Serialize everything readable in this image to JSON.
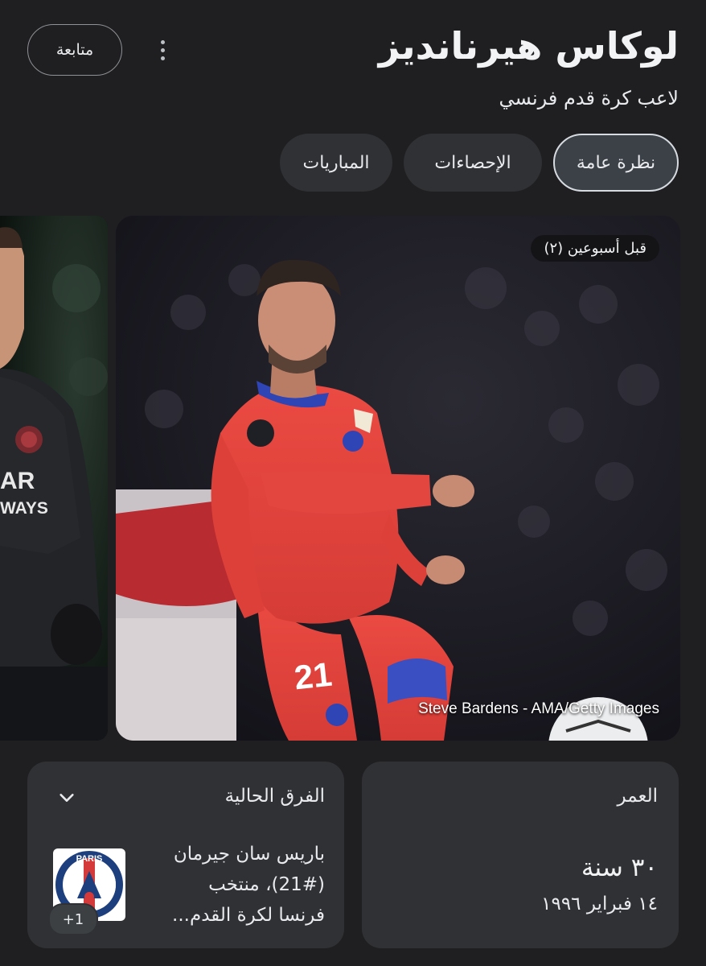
{
  "header": {
    "follow_label": "متابعة",
    "title": "لوكاس هيرنانديز",
    "subtitle": "لاعب كرة قدم فرنسي"
  },
  "tabs": [
    {
      "label": "نظرة عامة",
      "active": true
    },
    {
      "label": "الإحصاءات",
      "active": false
    },
    {
      "label": "المباريات",
      "active": false
    }
  ],
  "photo": {
    "time_badge": "قبل أسبوعين (٢)",
    "credit": "Steve Bardens - AMA/Getty Images",
    "jersey_number": "21",
    "side_shirt_text_1": "AR",
    "side_shirt_text_2": "WAYS"
  },
  "age_card": {
    "label": "العمر",
    "value": "٣٠ سنة",
    "birth_date": "١٤ فبراير ١٩٩٦"
  },
  "team_card": {
    "label": "الفرق الحالية",
    "line1": "باريس سان جيرمان",
    "line2": "(21#)، منتخب",
    "line3": "فرنسا لكرة القدم...",
    "more_badge": "+1",
    "logo_text": "PARIS"
  },
  "colors": {
    "background": "#1f1f21",
    "card": "#303134",
    "active_tab": "#3c4148",
    "kit_red": "#e2463f"
  }
}
